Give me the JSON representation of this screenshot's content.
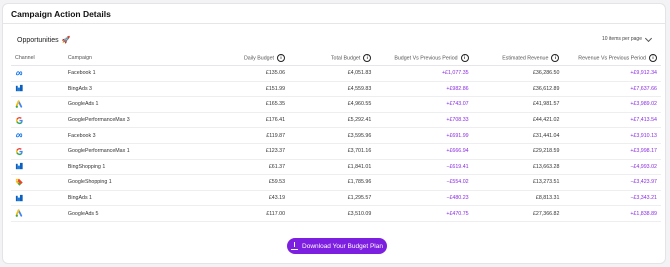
{
  "card": {
    "title": "Campaign Action Details"
  },
  "section": {
    "title": "Opportunities",
    "per_page": "10 items per page"
  },
  "columns": {
    "channel": "Channel",
    "campaign": "Campaign",
    "daily_budget": "Daily Budget",
    "total_budget": "Total Budget",
    "budget_vs_prev": "Budget Vs Previous Period",
    "est_revenue": "Estimated Revenue",
    "revenue_vs_prev": "Revenue Vs Previous Period"
  },
  "rows": [
    {
      "icon": "meta-icon",
      "campaign": "Facebook 1",
      "daily": "£135.06",
      "total": "£4,051.83",
      "bvp": "+£1,077.35",
      "rev": "£36,286.50",
      "rvp": "+£9,912.34"
    },
    {
      "icon": "bing-icon",
      "campaign": "BingAds 3",
      "daily": "£151.99",
      "total": "£4,559.83",
      "bvp": "+£982.86",
      "rev": "£36,612.89",
      "rvp": "+£7,637.66"
    },
    {
      "icon": "google-ads-icon",
      "campaign": "GoogleAds 1",
      "daily": "£165.35",
      "total": "£4,960.55",
      "bvp": "+£743.07",
      "rev": "£41,981.57",
      "rvp": "+£3,989.02"
    },
    {
      "icon": "google-icon",
      "campaign": "GooglePerformanceMax 3",
      "daily": "£176.41",
      "total": "£5,292.41",
      "bvp": "+£708.33",
      "rev": "£44,421.02",
      "rvp": "+£7,413.54"
    },
    {
      "icon": "meta-icon",
      "campaign": "Facebook 3",
      "daily": "£119.87",
      "total": "£3,595.96",
      "bvp": "+£691.99",
      "rev": "£31,441.04",
      "rvp": "+£3,910.13"
    },
    {
      "icon": "google-icon",
      "campaign": "GooglePerformanceMax 1",
      "daily": "£123.37",
      "total": "£3,701.16",
      "bvp": "+£666.94",
      "rev": "£29,218.59",
      "rvp": "+£3,998.17"
    },
    {
      "icon": "bing-icon",
      "campaign": "BingShopping 1",
      "daily": "£61.37",
      "total": "£1,841.01",
      "bvp": "−£619.41",
      "rev": "£13,663.28",
      "rvp": "−£4,993.02"
    },
    {
      "icon": "google-shopping-icon",
      "campaign": "GoogleShopping 1",
      "daily": "£59.53",
      "total": "£1,785.96",
      "bvp": "−£554.02",
      "rev": "£13,273.51",
      "rvp": "−£3,423.97"
    },
    {
      "icon": "bing-icon",
      "campaign": "BingAds 1",
      "daily": "£43.19",
      "total": "£1,295.57",
      "bvp": "−£480.23",
      "rev": "£8,813.31",
      "rvp": "−£3,343.21"
    },
    {
      "icon": "google-ads-icon",
      "campaign": "GoogleAds 5",
      "daily": "£117.00",
      "total": "£3,510.09",
      "bvp": "+£470.75",
      "rev": "£27,366.82",
      "rvp": "+£1,838.89"
    }
  ],
  "download_label": "Download Your Budget Plan"
}
